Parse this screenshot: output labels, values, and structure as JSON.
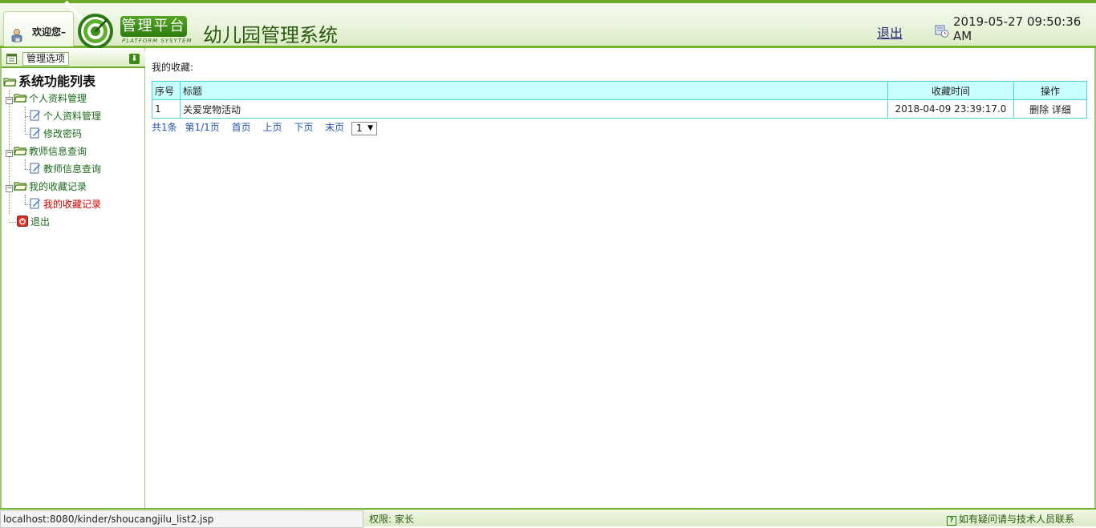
{
  "header": {
    "welcome": "欢迎您–",
    "badge_title": "管理平台",
    "badge_subtitle": "PLATFORM SYSYTEM",
    "site_title": "幼儿园管理系统",
    "logout": "退出",
    "datetime": "2019-05-27 09:50:36 AM"
  },
  "sidebar": {
    "bar_label": "管理选项",
    "tree_root": "系统功能列表",
    "groups": [
      {
        "label": "个人资料管理",
        "items": [
          {
            "label": "个人资料管理"
          },
          {
            "label": "修改密码"
          }
        ]
      },
      {
        "label": "教师信息查询",
        "items": [
          {
            "label": "教师信息查询"
          }
        ]
      },
      {
        "label": "我的收藏记录",
        "items": [
          {
            "label": "我的收藏记录",
            "active": true
          }
        ]
      }
    ],
    "logout": "退出"
  },
  "main": {
    "heading": "我的收藏:",
    "table": {
      "columns": [
        "序号",
        "标题",
        "收藏时间",
        "操作"
      ],
      "rows": [
        {
          "index": "1",
          "title": "关爱宠物活动",
          "time": "2018-04-09 23:39:17.0",
          "delete": "删除",
          "detail": "详细"
        }
      ]
    },
    "pager": {
      "total": "共1条",
      "page": "第1/1页",
      "first": "首页",
      "prev": "上页",
      "next": "下页",
      "last": "末页",
      "select_value": "1"
    }
  },
  "footer": {
    "status_url": "localhost:8080/kinder/shoucangjilu_list2.jsp",
    "role": "权限:  家长",
    "help": "如有疑问请与技术人员联系"
  },
  "colors": {
    "brand_green": "#6aaa28",
    "table_header_bg": "#c8ffff",
    "table_border": "#4fd6d6",
    "active_link": "#cc0000"
  }
}
